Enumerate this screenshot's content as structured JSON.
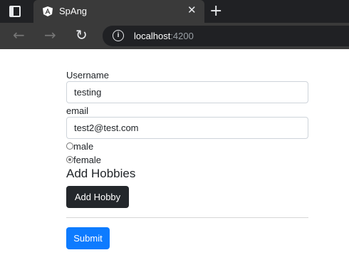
{
  "browser": {
    "tab_title": "SpAng",
    "url_host": "localhost",
    "url_port": ":4200"
  },
  "form": {
    "username_label": "Username",
    "username_value": "testing",
    "email_label": "email",
    "email_value": "test2@test.com",
    "gender_options": [
      {
        "label": "male",
        "checked": false
      },
      {
        "label": "female",
        "checked": true
      }
    ],
    "hobbies_title": "Add Hobbies",
    "add_hobby_label": "Add Hobby",
    "submit_label": "Submit"
  },
  "colors": {
    "primary": "#0d7bff",
    "dark_button": "#23272b",
    "angular_red": "#dd0031"
  }
}
